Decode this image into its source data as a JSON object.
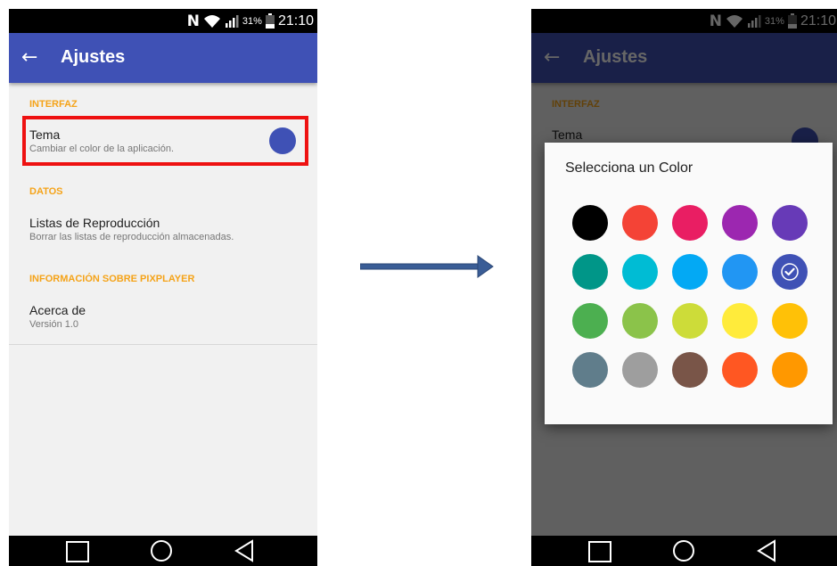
{
  "status_bar": {
    "nfc_label": "N",
    "battery_percent": "31%",
    "time": "21:10"
  },
  "app_bar": {
    "title": "Ajustes",
    "back_icon": "arrow-left-icon"
  },
  "settings": {
    "sections": [
      {
        "header": "INTERFAZ",
        "items": [
          {
            "title": "Tema",
            "summary": "Cambiar el color de la aplicación.",
            "color": "#3f51b5"
          }
        ]
      },
      {
        "header": "DATOS",
        "items": [
          {
            "title": "Listas de Reproducción",
            "summary": "Borrar las listas de reproducción almacenadas."
          }
        ]
      },
      {
        "header": "INFORMACIÓN SOBRE PIXPLAYER",
        "items": [
          {
            "title": "Acerca de",
            "summary": "Versión 1.0"
          }
        ]
      }
    ]
  },
  "color_dialog": {
    "title": "Selecciona un Color",
    "selected_index": 9,
    "colors": [
      "#000000",
      "#f44336",
      "#e91e63",
      "#9c27b0",
      "#673ab7",
      "#009688",
      "#00bcd4",
      "#03a9f4",
      "#2196f3",
      "#3f51b5",
      "#4caf50",
      "#8bc34a",
      "#cddc39",
      "#ffeb3b",
      "#ffc107",
      "#607d8b",
      "#9e9e9e",
      "#795548",
      "#ff5722",
      "#ff9800"
    ]
  },
  "nav_bar": {
    "icons": [
      "square-icon",
      "circle-icon",
      "triangle-back-icon"
    ]
  },
  "colors": {
    "primary": "#3f51b5",
    "accent": "#f5a318",
    "highlight": "#ee1111",
    "flow_arrow": "#3a5d96"
  }
}
